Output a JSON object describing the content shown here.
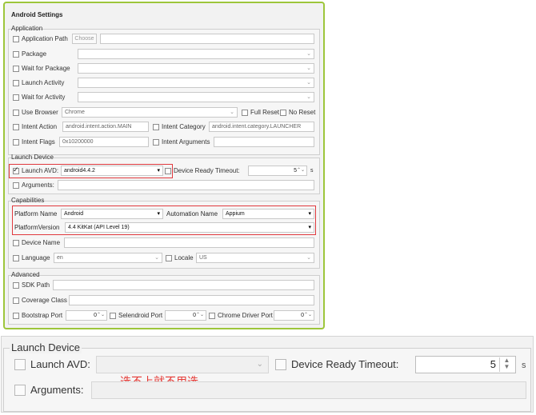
{
  "dialog": {
    "title": "Android Settings",
    "application": {
      "legend": "Application",
      "app_path_label": "Application Path",
      "choose_button": "Choose",
      "app_path_value": "",
      "package_label": "Package",
      "wait_package_label": "Wait for Package",
      "launch_activity_label": "Launch Activity",
      "wait_activity_label": "Wait for Activity",
      "use_browser_label": "Use Browser",
      "browser_value": "Chrome",
      "full_reset_label": "Full Reset",
      "no_reset_label": "No Reset",
      "intent_action_label": "Intent Action",
      "intent_action_value": "android.intent.action.MAIN",
      "intent_category_label": "Intent Category",
      "intent_category_value": "android.intent.category.LAUNCHER",
      "intent_flags_label": "Intent Flags",
      "intent_flags_value": "0x10200000",
      "intent_args_label": "Intent Arguments"
    },
    "launch_device": {
      "legend": "Launch Device",
      "launch_avd_label": "Launch AVD:",
      "avd_value": "android4.4.2",
      "ready_timeout_label": "Device Ready Timeout:",
      "timeout_value": "5",
      "timeout_unit": "s",
      "arguments_label": "Arguments:"
    },
    "capabilities": {
      "legend": "Capabilities",
      "platform_name_label": "Platform Name",
      "platform_name_value": "Android",
      "automation_name_label": "Automation Name",
      "automation_name_value": "Appium",
      "platform_version_label": "PlatformVersion",
      "platform_version_value": "4.4 KitKat (API Level 19)",
      "device_name_label": "Device Name",
      "language_label": "Language",
      "language_value": "en",
      "locale_label": "Locale",
      "locale_value": "US"
    },
    "advanced": {
      "legend": "Advanced",
      "sdk_path_label": "SDK Path",
      "coverage_label": "Coverage Class",
      "bootstrap_label": "Bootstrap Port",
      "bootstrap_value": "0",
      "selendroid_label": "Selendroid Port",
      "selendroid_value": "0",
      "chrome_driver_label": "Chrome Driver Port",
      "chrome_driver_value": "0"
    }
  },
  "zoom": {
    "legend": "Launch Device",
    "launch_avd_label": "Launch AVD:",
    "ready_timeout_label": "Device Ready Timeout:",
    "timeout_value": "5",
    "timeout_unit": "s",
    "arguments_label": "Arguments:",
    "note": "选不上就不用选"
  },
  "colors": {
    "dialog_border": "#9dc63b",
    "highlight": "#e0393e",
    "note": "#e53935"
  }
}
